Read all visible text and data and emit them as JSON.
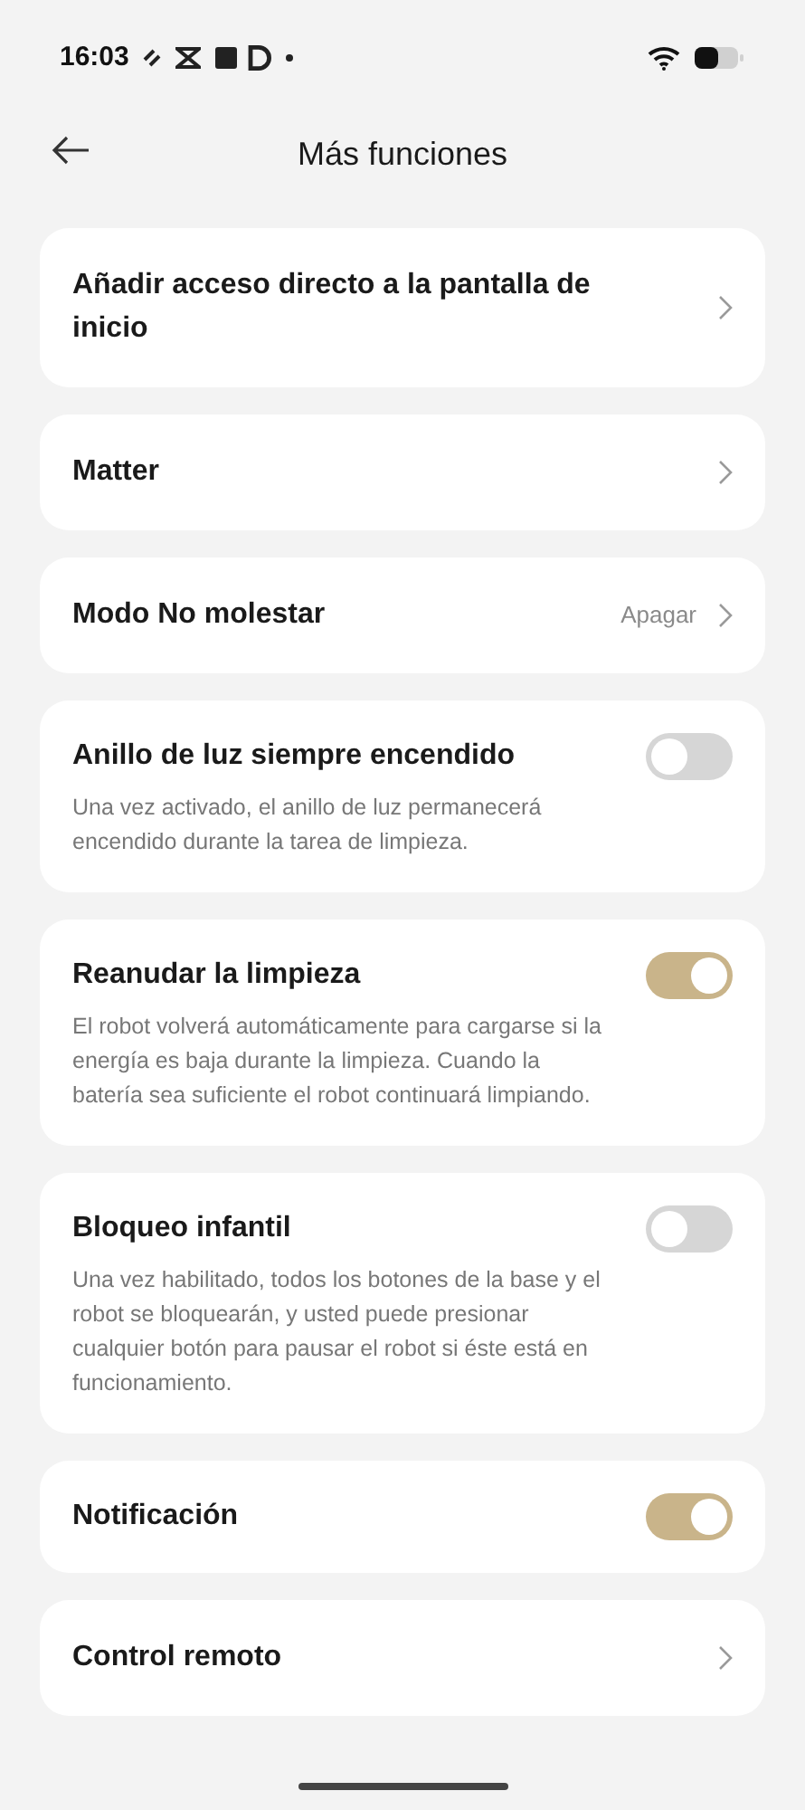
{
  "status_bar": {
    "time": "16:03"
  },
  "header": {
    "title": "Más funciones"
  },
  "items": [
    {
      "kind": "link",
      "title": "Añadir acceso directo a la pantalla de inicio"
    },
    {
      "kind": "link",
      "title": "Matter"
    },
    {
      "kind": "link",
      "title": "Modo No molestar",
      "value": "Apagar"
    },
    {
      "kind": "toggle",
      "title": "Anillo de luz siempre encendido",
      "description": "Una vez activado, el anillo de luz permanecerá encendido durante la tarea de limpieza.",
      "on": false
    },
    {
      "kind": "toggle",
      "title": "Reanudar la limpieza",
      "description": "El robot volverá automáticamente para cargarse si la energía es baja durante la limpieza. Cuando la batería sea suficiente el robot continuará limpiando.",
      "on": true
    },
    {
      "kind": "toggle",
      "title": "Bloqueo infantil",
      "description": "Una vez habilitado, todos los botones de la base y el robot se bloquearán, y usted puede presionar cualquier botón para pausar el robot si éste está en funcionamiento.",
      "on": false
    },
    {
      "kind": "toggle",
      "title": "Notificación",
      "on": true
    },
    {
      "kind": "link",
      "title": "Control remoto"
    }
  ]
}
